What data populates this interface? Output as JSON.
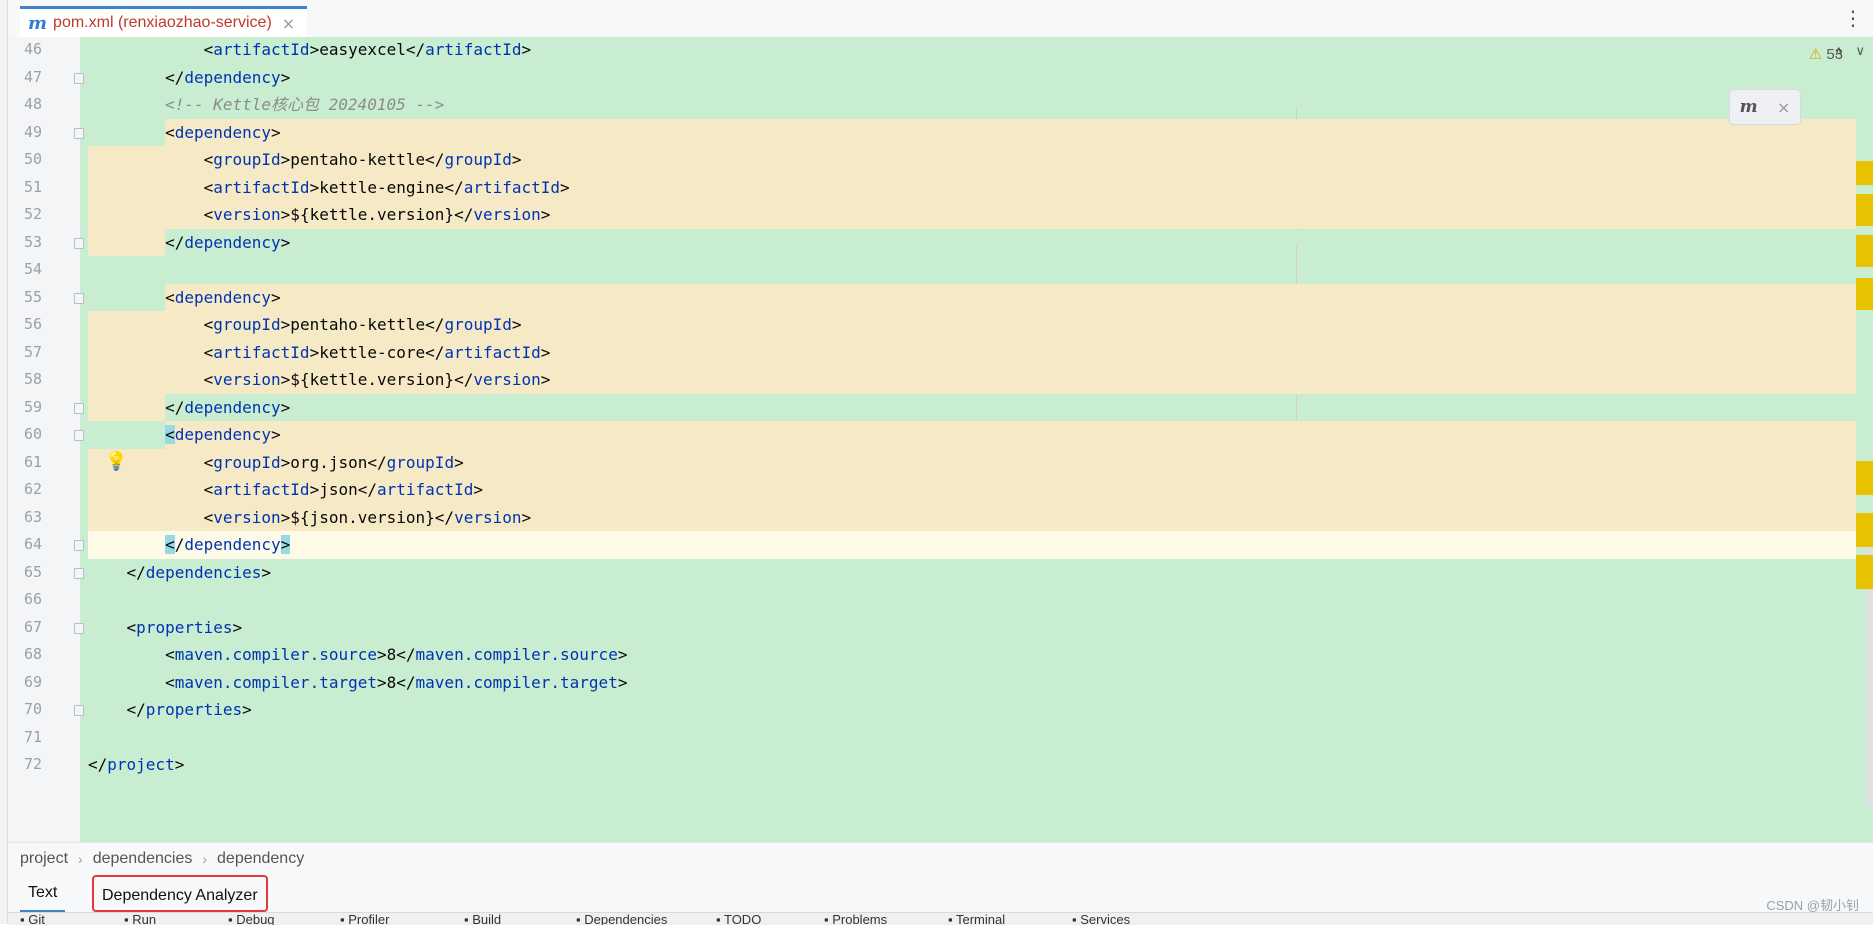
{
  "editor_tab": {
    "icon": "m",
    "label": "pom.xml (renxiaozhao-service)",
    "close": "×"
  },
  "inspections": {
    "warning_count": "53"
  },
  "lines": [
    {
      "n": "46",
      "t": "            <artifactId>easyexcel</artifactId>"
    },
    {
      "n": "47",
      "t": "        </dependency>"
    },
    {
      "n": "48",
      "t": "        <!-- Kettle核心包 20240105 -->"
    },
    {
      "n": "49",
      "t": "        <dependency>"
    },
    {
      "n": "50",
      "t": "            <groupId>pentaho-kettle</groupId>"
    },
    {
      "n": "51",
      "t": "            <artifactId>kettle-engine</artifactId>"
    },
    {
      "n": "52",
      "t": "            <version>${kettle.version}</version>"
    },
    {
      "n": "53",
      "t": "        </dependency>"
    },
    {
      "n": "54",
      "t": ""
    },
    {
      "n": "55",
      "t": "        <dependency>"
    },
    {
      "n": "56",
      "t": "            <groupId>pentaho-kettle</groupId>"
    },
    {
      "n": "57",
      "t": "            <artifactId>kettle-core</artifactId>"
    },
    {
      "n": "58",
      "t": "            <version>${kettle.version}</version>"
    },
    {
      "n": "59",
      "t": "        </dependency>"
    },
    {
      "n": "60",
      "t": "        <dependency>"
    },
    {
      "n": "61",
      "t": "            <groupId>org.json</groupId>"
    },
    {
      "n": "62",
      "t": "            <artifactId>json</artifactId>"
    },
    {
      "n": "63",
      "t": "            <version>${json.version}</version>"
    },
    {
      "n": "64",
      "t": "        </dependency>"
    },
    {
      "n": "65",
      "t": "    </dependencies>"
    },
    {
      "n": "66",
      "t": ""
    },
    {
      "n": "67",
      "t": "    <properties>"
    },
    {
      "n": "68",
      "t": "        <maven.compiler.source>8</maven.compiler.source>"
    },
    {
      "n": "69",
      "t": "        <maven.compiler.target>8</maven.compiler.target>"
    },
    {
      "n": "70",
      "t": "    </properties>"
    },
    {
      "n": "71",
      "t": ""
    },
    {
      "n": "72",
      "t": "</project>"
    }
  ],
  "breadcrumb": [
    "project",
    "dependencies",
    "dependency"
  ],
  "bottom_tabs": {
    "text": "Text",
    "dependency_analyzer": "Dependency Analyzer"
  },
  "toolstrip": [
    "Git",
    "Run",
    "Debug",
    "Profiler",
    "Build",
    "Dependencies",
    "TODO",
    "Problems",
    "Terminal",
    "Services"
  ],
  "watermark": "CSDN @韧小钊",
  "colors": {
    "changed_bg": "#c8edd0",
    "modified_bg": "#f5e9c6",
    "tag": "#0033b3",
    "accent": "#4083c9",
    "highlight_border": "#e53935"
  }
}
